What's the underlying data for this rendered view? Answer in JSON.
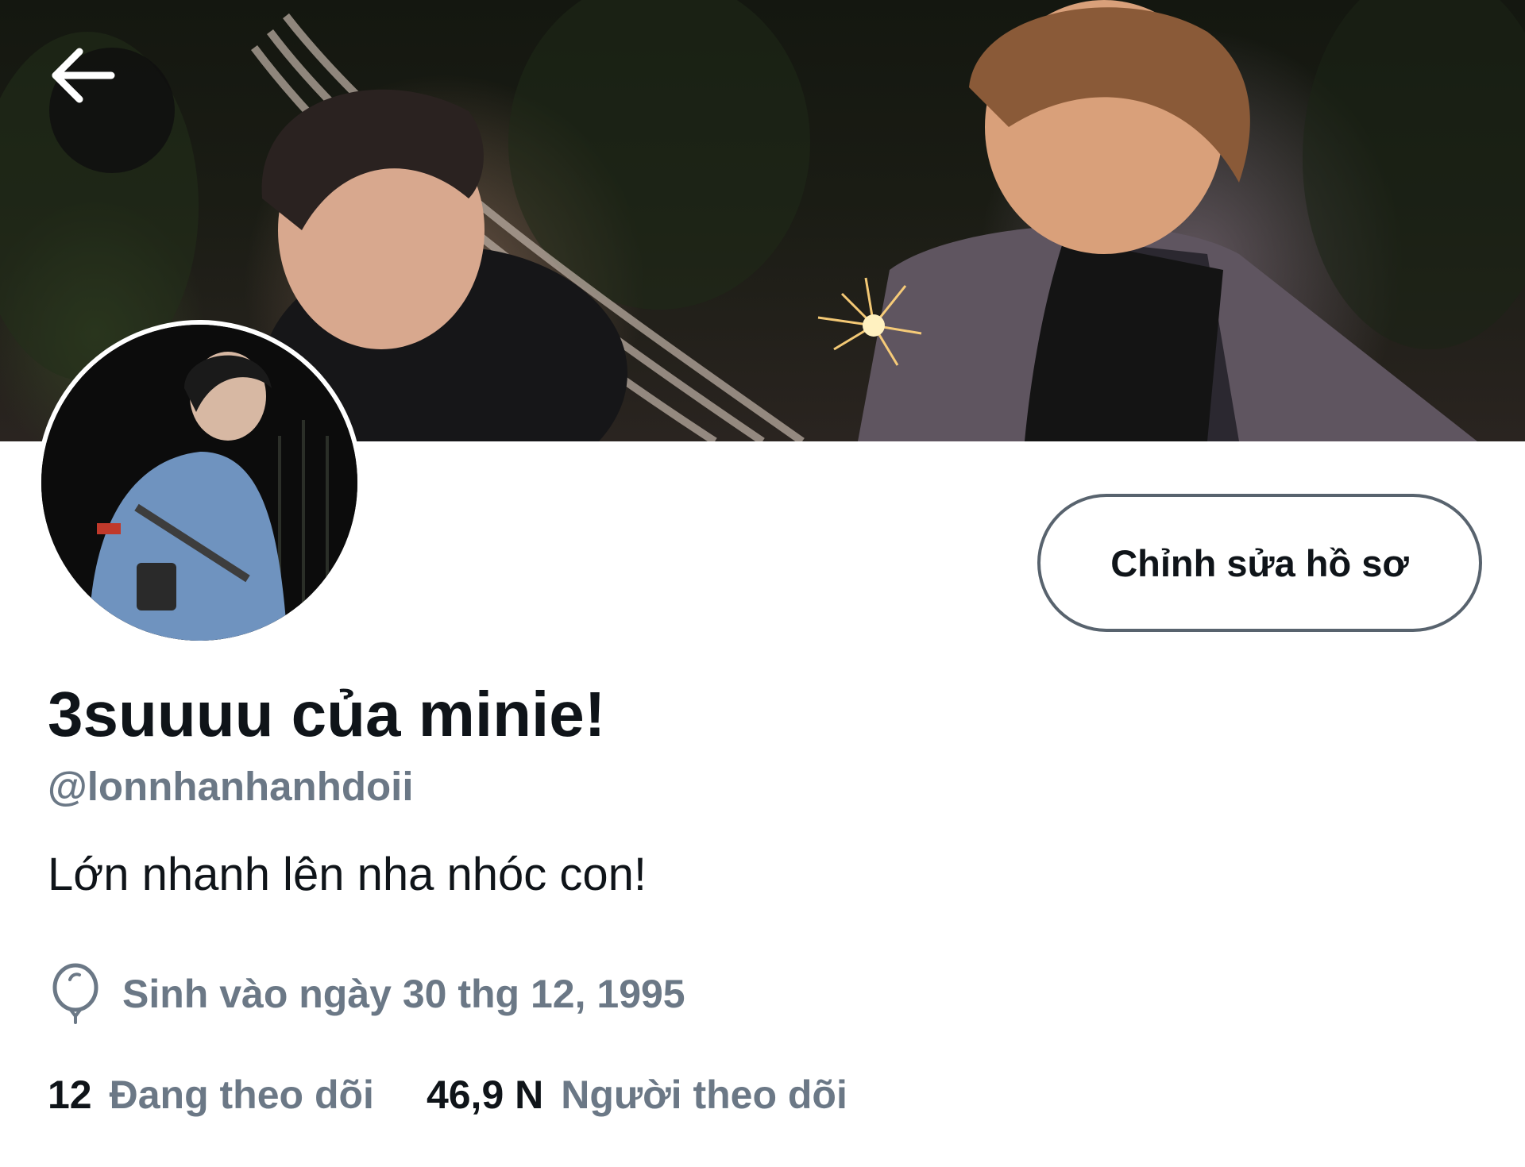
{
  "header": {
    "back_icon": "arrow-left-icon",
    "banner_description": "",
    "colors": {
      "back_button_bg": "#0f0f0f",
      "banner_dark": "#141710"
    }
  },
  "profile": {
    "display_name": "3suuuu của minie!",
    "handle": "@lonnhanhanhdoii",
    "bio": "Lớn nhanh lên nha nhóc con!",
    "birth_icon": "balloon-icon",
    "birth_text": "Sinh vào ngày 30 thg 12, 1995",
    "edit_button_label": "Chỉnh sửa hồ sơ"
  },
  "stats": {
    "following_count": "12",
    "following_label": "Đang theo dõi",
    "followers_count": "46,9 N",
    "followers_label": "Người theo dõi"
  },
  "colors": {
    "primary_text": "#0f1419",
    "secondary_text": "#6b7886",
    "button_border": "#58636e",
    "background": "#ffffff"
  }
}
